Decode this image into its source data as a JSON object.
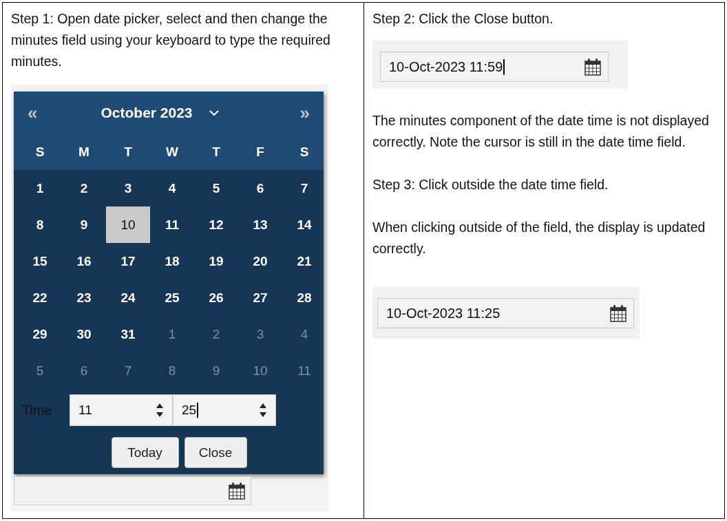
{
  "step1": {
    "instruction": "Step 1: Open date picker, select and then change the minutes field using your keyboard to type the required minutes.",
    "picker": {
      "prev": "«",
      "next": "»",
      "month": "October 2023",
      "weekdays": [
        "S",
        "M",
        "T",
        "W",
        "T",
        "F",
        "S"
      ],
      "weeks": [
        [
          {
            "day": "1",
            "outside": false,
            "selected": false
          },
          {
            "day": "2",
            "outside": false,
            "selected": false
          },
          {
            "day": "3",
            "outside": false,
            "selected": false
          },
          {
            "day": "4",
            "outside": false,
            "selected": false
          },
          {
            "day": "5",
            "outside": false,
            "selected": false
          },
          {
            "day": "6",
            "outside": false,
            "selected": false
          },
          {
            "day": "7",
            "outside": false,
            "selected": false
          }
        ],
        [
          {
            "day": "8",
            "outside": false,
            "selected": false
          },
          {
            "day": "9",
            "outside": false,
            "selected": false
          },
          {
            "day": "10",
            "outside": false,
            "selected": true
          },
          {
            "day": "11",
            "outside": false,
            "selected": false
          },
          {
            "day": "12",
            "outside": false,
            "selected": false
          },
          {
            "day": "13",
            "outside": false,
            "selected": false
          },
          {
            "day": "14",
            "outside": false,
            "selected": false
          }
        ],
        [
          {
            "day": "15",
            "outside": false,
            "selected": false
          },
          {
            "day": "16",
            "outside": false,
            "selected": false
          },
          {
            "day": "17",
            "outside": false,
            "selected": false
          },
          {
            "day": "18",
            "outside": false,
            "selected": false
          },
          {
            "day": "19",
            "outside": false,
            "selected": false
          },
          {
            "day": "20",
            "outside": false,
            "selected": false
          },
          {
            "day": "21",
            "outside": false,
            "selected": false
          }
        ],
        [
          {
            "day": "22",
            "outside": false,
            "selected": false
          },
          {
            "day": "23",
            "outside": false,
            "selected": false
          },
          {
            "day": "24",
            "outside": false,
            "selected": false
          },
          {
            "day": "25",
            "outside": false,
            "selected": false
          },
          {
            "day": "26",
            "outside": false,
            "selected": false
          },
          {
            "day": "27",
            "outside": false,
            "selected": false
          },
          {
            "day": "28",
            "outside": false,
            "selected": false
          }
        ],
        [
          {
            "day": "29",
            "outside": false,
            "selected": false
          },
          {
            "day": "30",
            "outside": false,
            "selected": false
          },
          {
            "day": "31",
            "outside": false,
            "selected": false
          },
          {
            "day": "1",
            "outside": true,
            "selected": false
          },
          {
            "day": "2",
            "outside": true,
            "selected": false
          },
          {
            "day": "3",
            "outside": true,
            "selected": false
          },
          {
            "day": "4",
            "outside": true,
            "selected": false
          }
        ],
        [
          {
            "day": "5",
            "outside": true,
            "selected": false
          },
          {
            "day": "6",
            "outside": true,
            "selected": false
          },
          {
            "day": "7",
            "outside": true,
            "selected": false
          },
          {
            "day": "8",
            "outside": true,
            "selected": false
          },
          {
            "day": "9",
            "outside": true,
            "selected": false
          },
          {
            "day": "10",
            "outside": true,
            "selected": false
          },
          {
            "day": "11",
            "outside": true,
            "selected": false
          }
        ]
      ],
      "time_label": "Time",
      "hours": {
        "value": "11",
        "cursor": false
      },
      "minutes": {
        "value": "25",
        "cursor": true
      },
      "buttons": [
        "Today",
        "Close"
      ]
    }
  },
  "step2": {
    "instruction": "Step 2: Click the Close button.",
    "field": {
      "value": "10-Oct-2023 11:59",
      "cursor": true
    },
    "note": "The minutes component of the date time is not displayed correctly. Note the cursor is still in the date time field."
  },
  "step3": {
    "instruction": "Step 3: Click outside the date time field.",
    "note": "When clicking outside of the field, the display is updated correctly.",
    "field": {
      "value": "10-Oct-2023 11:25",
      "cursor": false
    }
  }
}
